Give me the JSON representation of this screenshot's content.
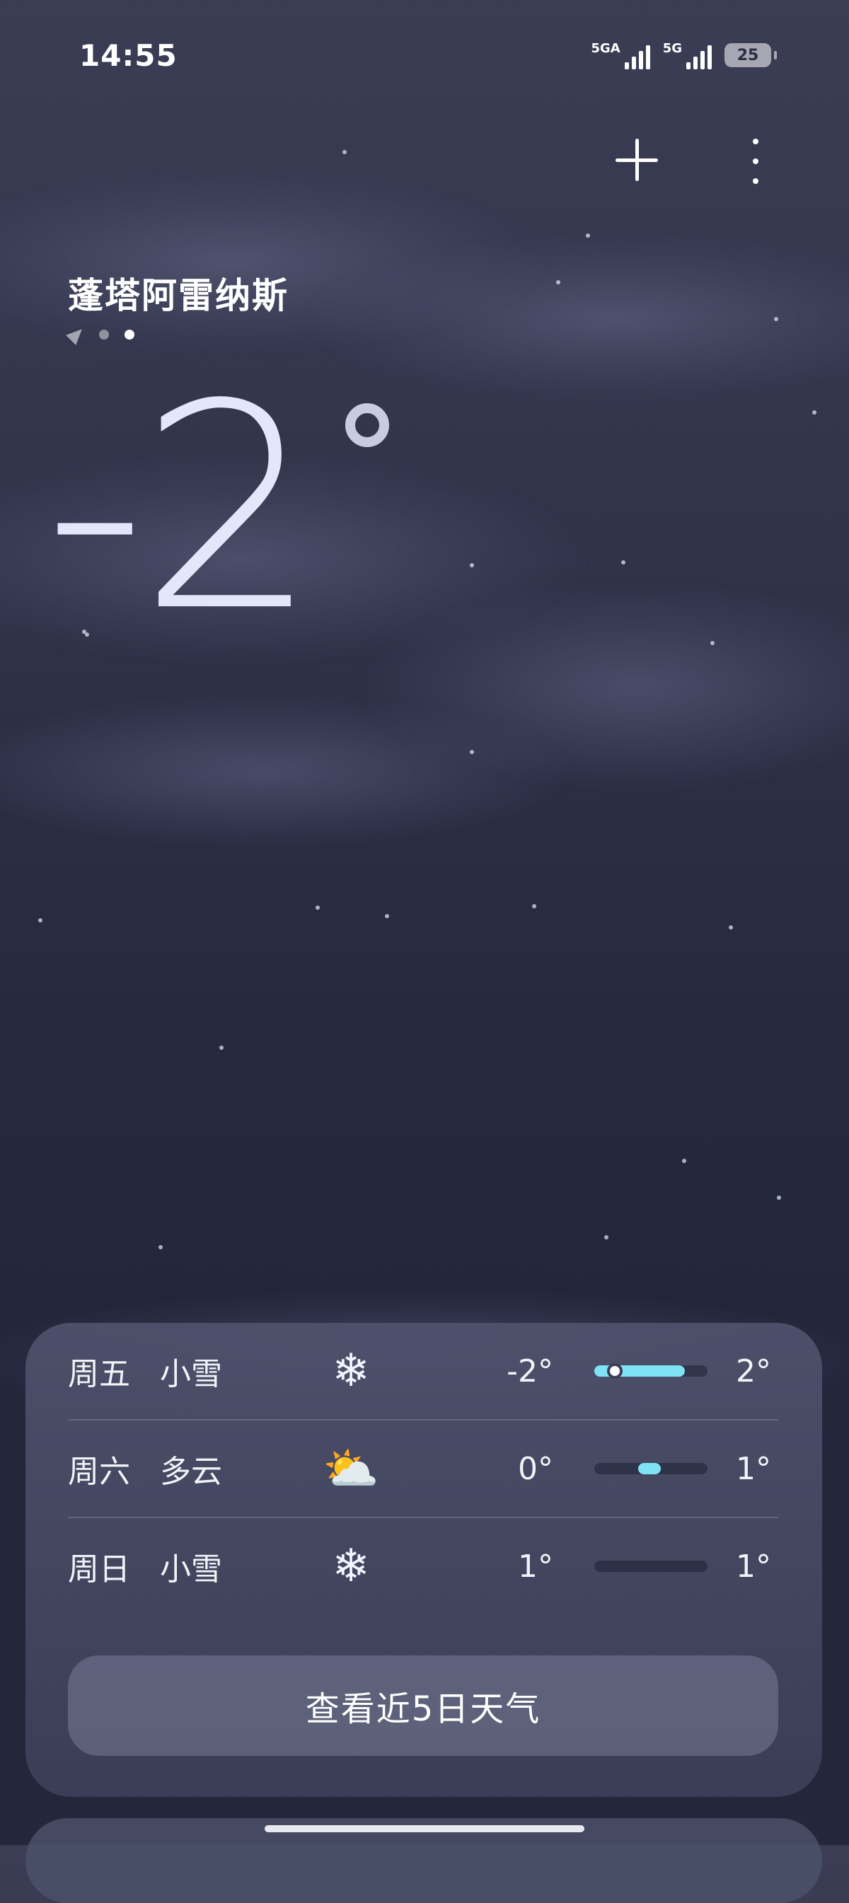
{
  "status_bar": {
    "time": "14:55",
    "network1": "5GA",
    "network2": "5G",
    "battery": "25"
  },
  "header": {
    "add_icon": "plus-icon",
    "more_icon": "more-vertical-icon"
  },
  "location": {
    "city": "蓬塔阿雷纳斯",
    "page_count": 2,
    "active_page": 2
  },
  "current": {
    "temperature": "-2"
  },
  "forecast": [
    {
      "day": "周五",
      "condition": "小雪",
      "icon": "snowflake-icon",
      "glyph": "❄",
      "low": "-2°",
      "high": "2°",
      "range_start": 0.0,
      "range_end": 0.8,
      "current_pos": 0.18
    },
    {
      "day": "周六",
      "condition": "多云",
      "icon": "partly-cloudy-icon",
      "glyph": "⛅",
      "low": "0°",
      "high": "1°",
      "range_start": 0.4,
      "range_end": 0.6,
      "current_pos": null
    },
    {
      "day": "周日",
      "condition": "小雪",
      "icon": "snowflake-icon",
      "glyph": "❄",
      "low": "1°",
      "high": "1°",
      "range_start": null,
      "range_end": null,
      "current_pos": null
    }
  ],
  "view_button": "查看近5日天气",
  "colors": {
    "range_fill": "#7ee3f4",
    "background_top": "#3b3d55",
    "background_bottom": "#23273b"
  }
}
